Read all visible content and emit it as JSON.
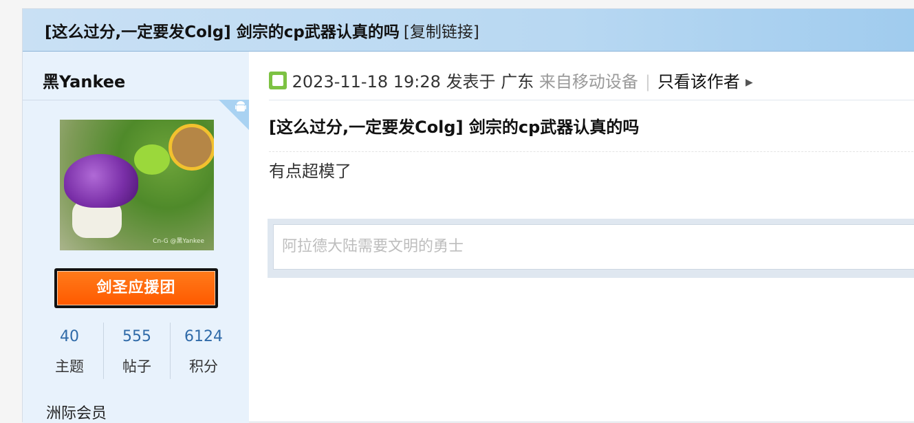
{
  "thread": {
    "title": "[这么过分,一定要发Colg] 剑宗的cp武器认真的吗",
    "copy_link": "[复制链接]"
  },
  "user": {
    "name": "黑Yankee",
    "avatar_credit": "Cn-G @黑Yankee",
    "badge": "剑圣应援团",
    "stats": [
      {
        "value": "40",
        "label": "主题"
      },
      {
        "value": "555",
        "label": "帖子"
      },
      {
        "value": "6124",
        "label": "积分"
      }
    ],
    "more_label": "洲际会员"
  },
  "post": {
    "date": "2023-11-18 19:28",
    "posted_in": "发表于 广东",
    "source": "来自移动设备",
    "divider": "|",
    "only_author": "只看该作者",
    "title": "[这么过分,一定要发Colg] 剑宗的cp武器认真的吗",
    "body": "有点超模了"
  },
  "reply": {
    "placeholder": "阿拉德大陆需要文明的勇士"
  },
  "icons": {
    "device": "android-icon",
    "poster": "poster-icon",
    "arrow": "triangle-right-icon"
  }
}
